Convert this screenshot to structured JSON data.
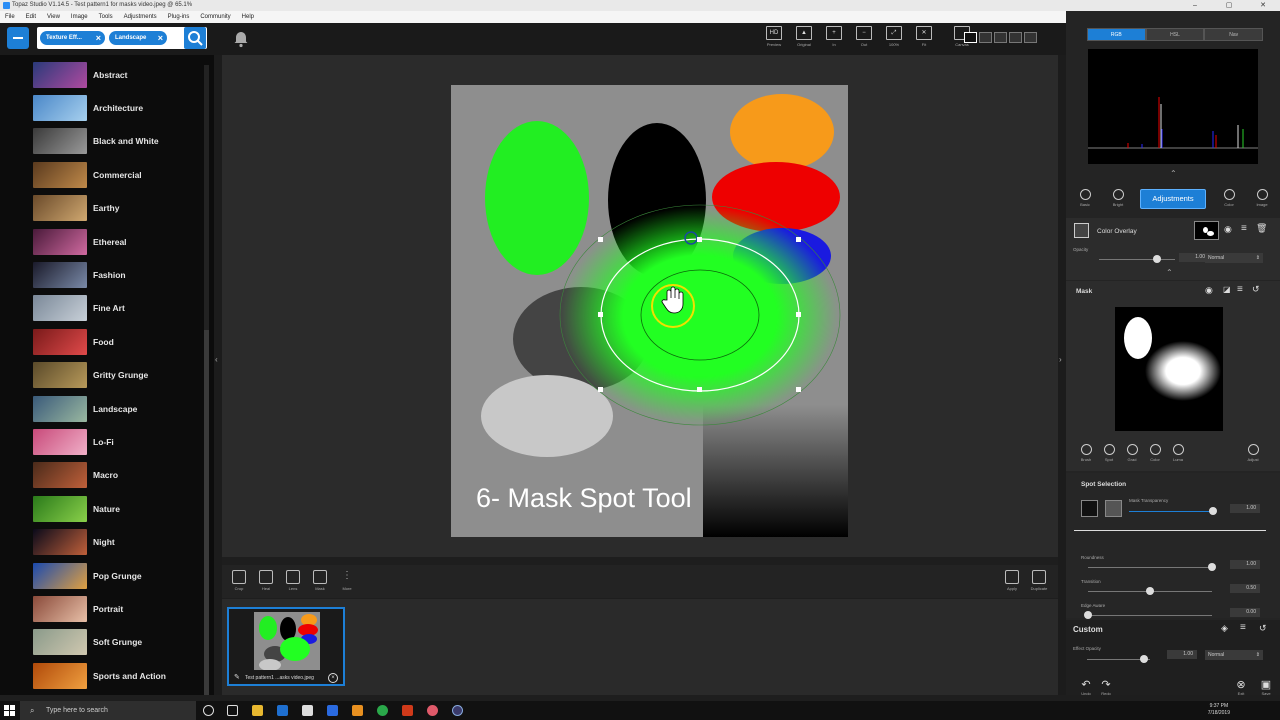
{
  "window": {
    "title": "Topaz Studio V1.14.5 - Test pattern1 for masks video.jpeg @ 65.1%",
    "controls": [
      "–",
      "▢",
      "✕"
    ]
  },
  "menu": [
    "File",
    "Edit",
    "View",
    "Image",
    "Tools",
    "Adjustments",
    "Plug-ins",
    "Community",
    "Help"
  ],
  "search": {
    "chips": [
      "Texture Eff...",
      "Landscape"
    ]
  },
  "view_tools": [
    {
      "icon": "hd-preview-icon",
      "glyph": "HD",
      "label": "Preview"
    },
    {
      "icon": "original-image-icon",
      "glyph": "▲",
      "label": "Original"
    },
    {
      "icon": "zoom-in-icon",
      "glyph": "+",
      "label": "In"
    },
    {
      "icon": "zoom-out-icon",
      "glyph": "−",
      "label": "Out"
    },
    {
      "icon": "zoom-100-icon",
      "glyph": "⤢",
      "label": "100%"
    },
    {
      "icon": "fit-icon",
      "glyph": "✕",
      "label": "Fit"
    },
    {
      "icon": "canvas-icon",
      "glyph": "",
      "label": "Canvas"
    }
  ],
  "categories": [
    {
      "label": "Abstract",
      "colors": [
        "#2a3a7a",
        "#b04aa0"
      ]
    },
    {
      "label": "Architecture",
      "colors": [
        "#4a87c8",
        "#a7d0ee"
      ]
    },
    {
      "label": "Black and White",
      "colors": [
        "#3a3a3a",
        "#9a9a9a"
      ]
    },
    {
      "label": "Commercial",
      "colors": [
        "#5a3a1e",
        "#c08a4a"
      ]
    },
    {
      "label": "Earthy",
      "colors": [
        "#6a4a2a",
        "#d0a870"
      ]
    },
    {
      "label": "Ethereal",
      "colors": [
        "#4a1a3a",
        "#d06aa0"
      ]
    },
    {
      "label": "Fashion",
      "colors": [
        "#1a1a2a",
        "#7a8aa8"
      ]
    },
    {
      "label": "Fine Art",
      "colors": [
        "#7a8898",
        "#c8d0d8"
      ]
    },
    {
      "label": "Food",
      "colors": [
        "#7a1a1a",
        "#e04a4a"
      ]
    },
    {
      "label": "Gritty Grunge",
      "colors": [
        "#5a4a2a",
        "#b89a5a"
      ]
    },
    {
      "label": "Landscape",
      "colors": [
        "#3a5a7a",
        "#9ab8a0"
      ]
    },
    {
      "label": "Lo-Fi",
      "colors": [
        "#c84a7a",
        "#f0b0c8"
      ]
    },
    {
      "label": "Macro",
      "colors": [
        "#4a2a1a",
        "#c0603a"
      ]
    },
    {
      "label": "Nature",
      "colors": [
        "#2a7a1a",
        "#8ad04a"
      ]
    },
    {
      "label": "Night",
      "colors": [
        "#0a0a1a",
        "#c0603a"
      ]
    },
    {
      "label": "Pop Grunge",
      "colors": [
        "#1a4ab0",
        "#e0a040"
      ]
    },
    {
      "label": "Portrait",
      "colors": [
        "#8a4a3a",
        "#e8c0a8"
      ]
    },
    {
      "label": "Soft Grunge",
      "colors": [
        "#8a9a8a",
        "#d0c8b0"
      ]
    },
    {
      "label": "Sports and Action",
      "colors": [
        "#b04a0a",
        "#f0a040"
      ]
    }
  ],
  "canvas": {
    "caption": "6- Mask Spot Tool"
  },
  "bottom_tools": {
    "left": [
      {
        "icon": "crop-icon",
        "label": "Crop"
      },
      {
        "icon": "heal-icon",
        "label": "Heal"
      },
      {
        "icon": "lens-icon",
        "label": "Lens"
      },
      {
        "icon": "mask-icon",
        "label": "Mask"
      },
      {
        "icon": "more-icon",
        "label": "More"
      }
    ],
    "right": [
      {
        "icon": "apply-icon",
        "label": "Apply"
      },
      {
        "icon": "duplicate-icon",
        "label": "Duplicate"
      }
    ]
  },
  "filmstrip": {
    "label": "Test pattern1 ...asks video.jpeg"
  },
  "right_panel": {
    "tabs": [
      "RGB",
      "HSL",
      "Nav"
    ],
    "top_icons": [
      {
        "icon": "basic-icon",
        "label": "Basic"
      },
      {
        "icon": "bright-icon",
        "label": "Bright"
      },
      {
        "icon": "color-icon",
        "label": "Color"
      },
      {
        "icon": "image-icon",
        "label": "Image"
      }
    ],
    "adjustments_label": "Adjustments",
    "color_overlay": {
      "title": "Color Overlay",
      "opacity_label": "Opacity",
      "opacity_value": "1.00",
      "opacity_fraction": 0.76,
      "blend": "Normal"
    },
    "mask": {
      "title": "Mask",
      "tools": [
        {
          "icon": "brush-icon",
          "label": "Brush"
        },
        {
          "icon": "spot-icon",
          "label": "Spot"
        },
        {
          "icon": "grad-icon",
          "label": "Grad"
        },
        {
          "icon": "color-mask-icon",
          "label": "Color"
        },
        {
          "icon": "luma-icon",
          "label": "Luma"
        }
      ],
      "adjust_label": "Adjust"
    },
    "spot_selection": {
      "title": "Spot Selection",
      "transparency_label": "Mask Transparency",
      "transparency_value": "1.00",
      "transparency_fraction": 1.0,
      "sliders": [
        {
          "label": "Roundness",
          "value": "1.00",
          "fraction": 1.0
        },
        {
          "label": "Transition",
          "value": "0.50",
          "fraction": 0.5
        },
        {
          "label": "Edge Aware",
          "value": "0.00",
          "fraction": 0.0
        }
      ]
    },
    "custom": {
      "title": "Custom",
      "effect_opacity_label": "Effect Opacity",
      "effect_opacity_value": "1.00",
      "effect_opacity_fraction": 0.9,
      "blend": "Normal",
      "footer": [
        {
          "icon": "undo-icon",
          "label": "Undo"
        },
        {
          "icon": "redo-icon",
          "label": "Redo"
        },
        {
          "icon": "exit-icon",
          "label": "Exit"
        },
        {
          "icon": "save-icon",
          "label": "Save"
        }
      ]
    }
  },
  "taskbar": {
    "search_placeholder": "Type here to search",
    "time": "9:37 PM",
    "date": "7/18/2019"
  }
}
